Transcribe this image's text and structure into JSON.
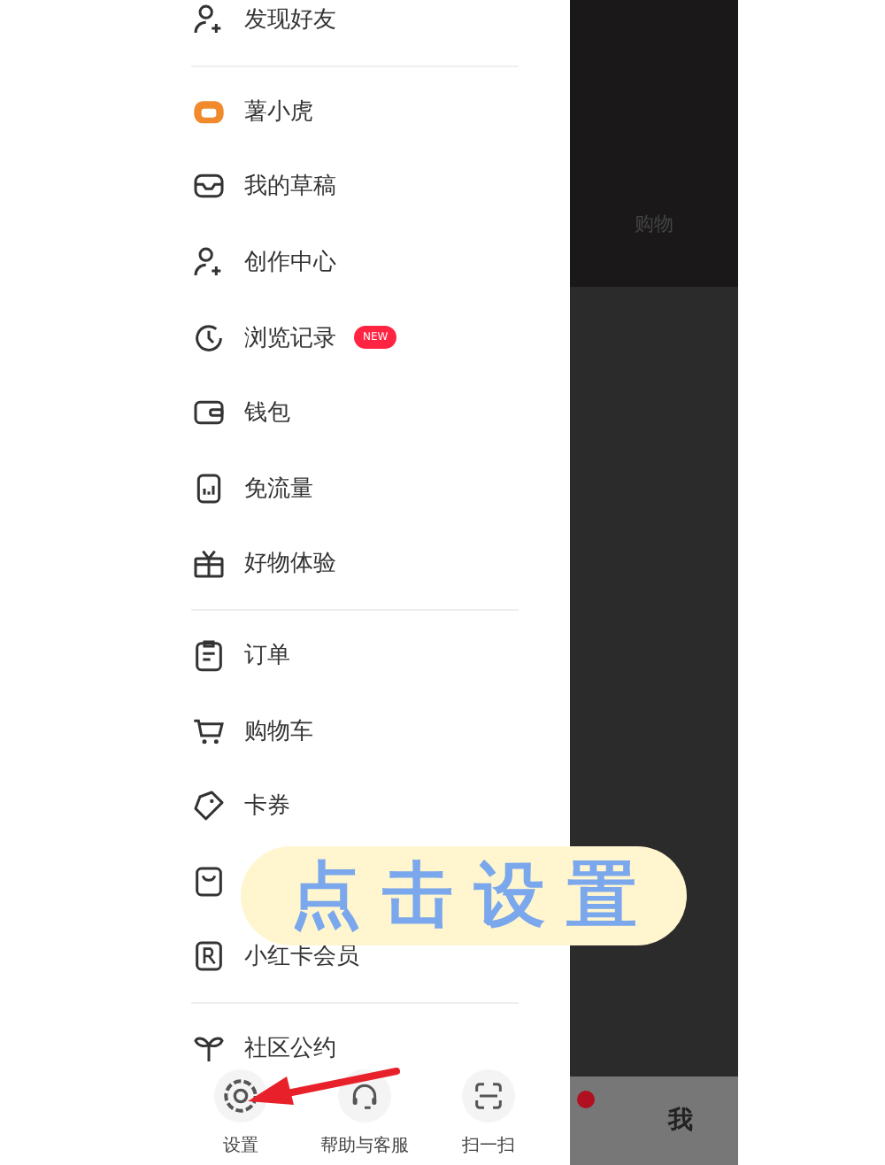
{
  "menu_sections": [
    {
      "items": [
        {
          "kind": "person-add",
          "label": "发现好友"
        }
      ]
    },
    {
      "items": [
        {
          "kind": "mascot",
          "label": "薯小虎"
        },
        {
          "kind": "inbox",
          "label": "我的草稿"
        },
        {
          "kind": "person-add",
          "label": "创作中心"
        },
        {
          "kind": "clock",
          "label": "浏览记录",
          "badge": "NEW"
        },
        {
          "kind": "wallet",
          "label": "钱包"
        },
        {
          "kind": "chart",
          "label": "免流量"
        },
        {
          "kind": "gift",
          "label": "好物体验"
        }
      ]
    },
    {
      "items": [
        {
          "kind": "clipboard",
          "label": "订单"
        },
        {
          "kind": "cart",
          "label": "购物车"
        },
        {
          "kind": "tag",
          "label": "卡券"
        },
        {
          "kind": "bag"
        },
        {
          "kind": "r-card",
          "label": "小红卡会员"
        }
      ]
    },
    {
      "items": [
        {
          "kind": "sprout",
          "label": "社区公约"
        }
      ]
    }
  ],
  "bottom_actions": [
    {
      "kind": "gear",
      "label": "设置"
    },
    {
      "kind": "headset",
      "label": "帮助与客服"
    },
    {
      "kind": "scan",
      "label": "扫一扫"
    }
  ],
  "background": {
    "section_title": "购物",
    "nav_label": "我"
  },
  "annotation": {
    "text": "点击设置"
  }
}
